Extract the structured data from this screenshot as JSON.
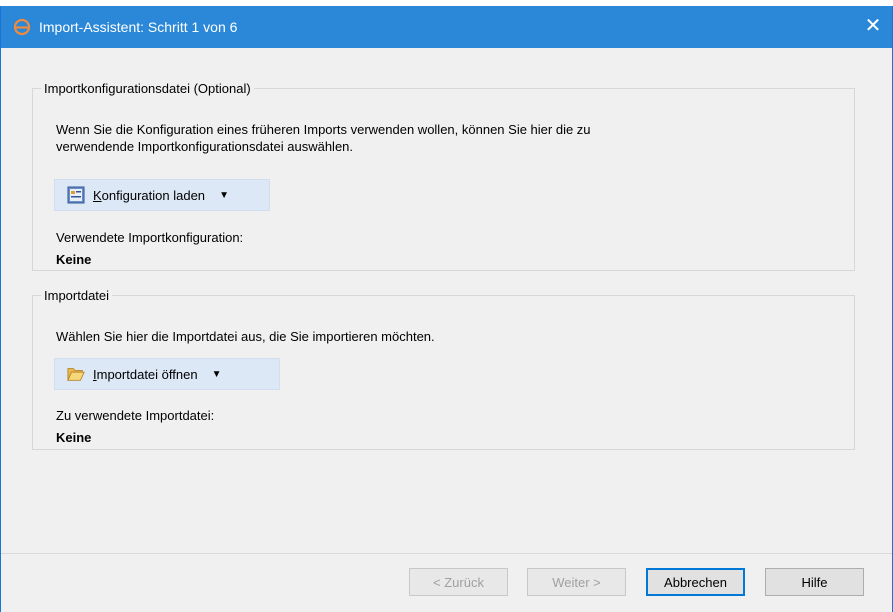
{
  "window": {
    "title": "Import-Assistent:  Schritt 1 von 6"
  },
  "config_group": {
    "legend": "Importkonfigurationsdatei (Optional)",
    "description_line1": "Wenn Sie die Konfiguration eines früheren Imports verwenden wollen, können Sie hier die zu",
    "description_line2": "verwendende Importkonfigurationsdatei auswählen.",
    "load_button_hotkey": "K",
    "load_button_rest": "onfiguration laden",
    "used_label": "Verwendete Importkonfiguration:",
    "used_value": "Keine"
  },
  "file_group": {
    "legend": "Importdatei",
    "description": "Wählen Sie hier die Importdatei aus, die Sie importieren möchten.",
    "open_button_hotkey": "I",
    "open_button_rest": "mportdatei öffnen",
    "used_label": "Zu verwendete Importdatei:",
    "used_value": "Keine"
  },
  "footer": {
    "back": "< Zurück",
    "next": "Weiter >",
    "cancel": "Abbrechen",
    "help": "Hilfe"
  },
  "icons": {
    "app": "app-logo-icon",
    "close": "close-icon",
    "config": "config-file-icon",
    "folder": "open-folder-icon",
    "dropdown": "chevron-down-icon"
  },
  "colors": {
    "titlebar": "#2b88d8",
    "button_face": "#dde8f6",
    "default_border": "#0078d7"
  }
}
